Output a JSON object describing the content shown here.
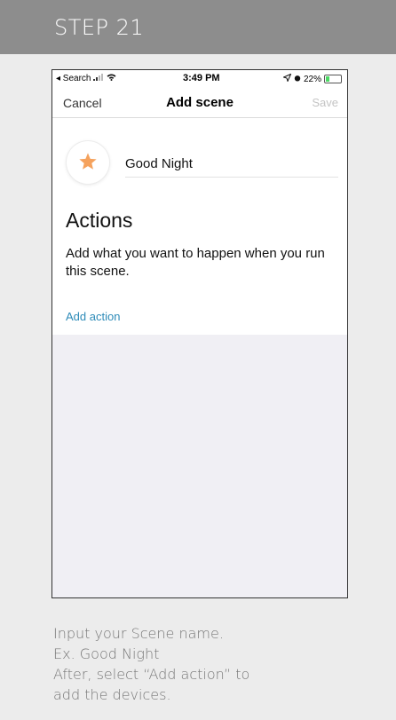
{
  "header": {
    "step_label": "STEP 21"
  },
  "status_bar": {
    "back_label": "◂ Search",
    "time": "3:49 PM",
    "battery_text": "22%",
    "battery_level": 0.22
  },
  "nav": {
    "cancel": "Cancel",
    "title": "Add scene",
    "save": "Save"
  },
  "scene": {
    "name": "Good Night",
    "icon": "star-icon",
    "icon_color": "#f5a25d"
  },
  "actions": {
    "title": "Actions",
    "description": "Add what you want to happen when you run this scene.",
    "add_action": "Add action"
  },
  "caption": {
    "line1": "Input your Scene name.",
    "line2": "Ex. Good Night",
    "line3": "After, select “Add action” to",
    "line4": "add the devices."
  },
  "colors": {
    "header_bg": "#8d8d8d",
    "link": "#2d8bb8",
    "disabled": "#c4c4c4"
  }
}
